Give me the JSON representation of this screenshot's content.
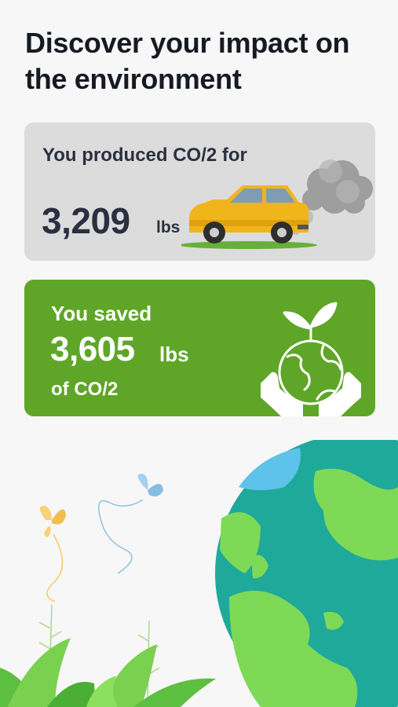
{
  "headline": "Discover your impact on the environment",
  "produced": {
    "label": "You produced CO/2 for",
    "amount": "3,209",
    "unit": "lbs",
    "illustration": "car-exhaust-icon"
  },
  "saved": {
    "label": "You saved",
    "amount": "3,605",
    "unit": "lbs",
    "suffix": "of CO/2",
    "illustration": "earth-in-hands-icon"
  },
  "colors": {
    "background": "#f7f7f7",
    "produced_card": "#dcdcdc",
    "saved_card": "#5fa628",
    "text_dark": "#161a22"
  }
}
